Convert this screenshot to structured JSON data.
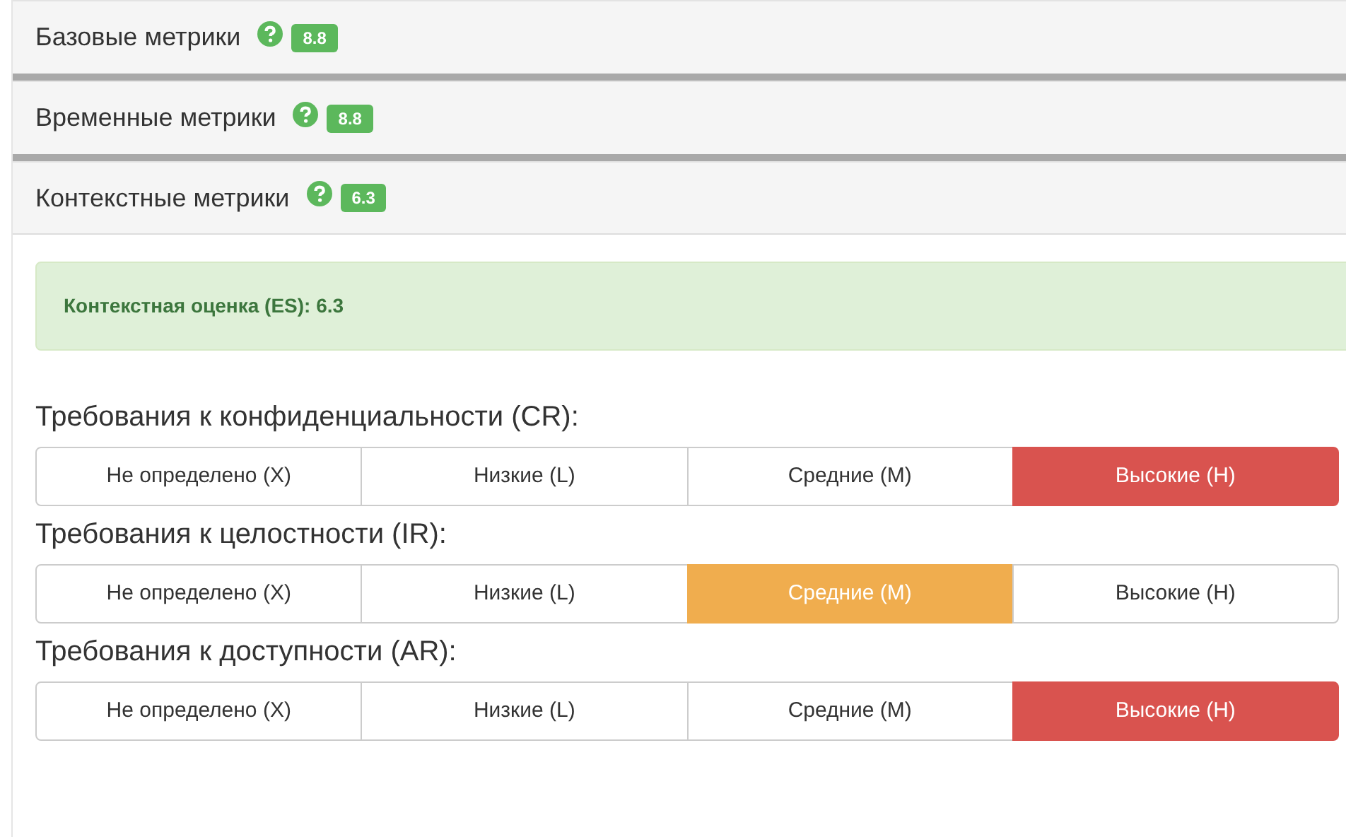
{
  "sections": [
    {
      "title": "Базовые метрики",
      "score": "8.8",
      "expanded": false
    },
    {
      "title": "Временные метрики",
      "score": "8.8",
      "expanded": false
    },
    {
      "title": "Контекстные метрики",
      "score": "6.3",
      "expanded": true
    }
  ],
  "alert": {
    "text": "Контекстная оценка (ES): 6.3"
  },
  "groups": [
    {
      "label": "Требования к конфиденциальности (CR):",
      "options": [
        {
          "label": "Не определено (X)",
          "selected": false
        },
        {
          "label": "Низкие (L)",
          "selected": false
        },
        {
          "label": "Средние (M)",
          "selected": false
        },
        {
          "label": "Высокие (H)",
          "selected": true,
          "color": "#d9534f"
        }
      ]
    },
    {
      "label": "Требования к целостности (IR):",
      "options": [
        {
          "label": "Не определено (X)",
          "selected": false
        },
        {
          "label": "Низкие (L)",
          "selected": false
        },
        {
          "label": "Средние (M)",
          "selected": true,
          "color": "#f0ad4e"
        },
        {
          "label": "Высокие (H)",
          "selected": false
        }
      ]
    },
    {
      "label": "Требования к доступности (AR):",
      "options": [
        {
          "label": "Не определено (X)",
          "selected": false
        },
        {
          "label": "Низкие (L)",
          "selected": false
        },
        {
          "label": "Средние (M)",
          "selected": false
        },
        {
          "label": "Высокие (H)",
          "selected": true,
          "color": "#d9534f"
        }
      ]
    }
  ]
}
